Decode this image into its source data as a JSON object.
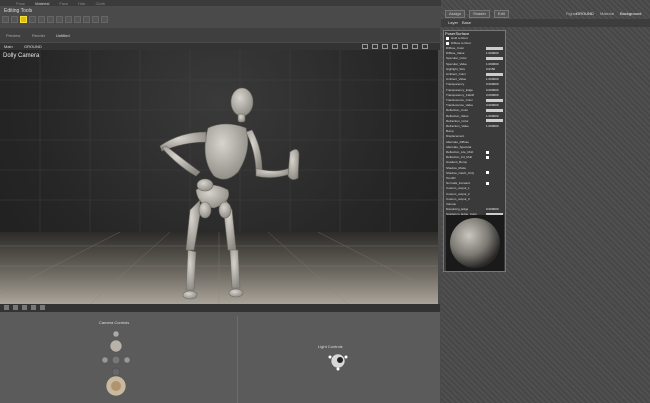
{
  "menu": {
    "items": [
      "Pose",
      "Material",
      "Face",
      "Hair",
      "Cloth"
    ],
    "active": "Material"
  },
  "title": "Editing Tools",
  "scene_tabs": [
    "Preview",
    "Render",
    "Untitled"
  ],
  "view": {
    "camera_select": "Main",
    "ground_select": "GROUND"
  },
  "viewport_label": "Dolly Camera",
  "camera_controls_label": "Camera Controls",
  "light_controls_label": "Light Controls",
  "right_panel": {
    "tabs": [
      "Assign",
      "Shader",
      "Edit"
    ],
    "figure_label": "Figure",
    "figure_value": "GROUND",
    "material_label": "Material",
    "material_value": "Background",
    "layer_label": "Layer",
    "layer_value": "Base",
    "panel_title": "PoserSurface",
    "checkbox_rows": [
      "Hold to Root",
      "Diffuse to Root"
    ],
    "rows": [
      {
        "label": "Diffuse_Color",
        "kind": "swatch"
      },
      {
        "label": "Diffuse_Value",
        "kind": "value",
        "value": "1.000000"
      },
      {
        "label": "Specular_Color",
        "kind": "swatch"
      },
      {
        "label": "Specular_Value",
        "kind": "value",
        "value": "1.000000"
      },
      {
        "label": "Highlight_Size",
        "kind": "value",
        "value": "0.0150"
      },
      {
        "label": "Ambient_Color",
        "kind": "swatch"
      },
      {
        "label": "Ambient_Value",
        "kind": "value",
        "value": "1.000000"
      },
      {
        "label": "Transparency",
        "kind": "value",
        "value": "0.000000"
      },
      {
        "label": "Transparency_Edge",
        "kind": "value",
        "value": "0.000000"
      },
      {
        "label": "Transparency_Falloff",
        "kind": "value",
        "value": "0.000000"
      },
      {
        "label": "Translucence_Color",
        "kind": "swatch"
      },
      {
        "label": "Translucence_Value",
        "kind": "value",
        "value": "0.000000"
      },
      {
        "label": "Reflection_Color",
        "kind": "swatch"
      },
      {
        "label": "Reflection_Value",
        "kind": "value",
        "value": "1.000000"
      },
      {
        "label": "Refraction_Color",
        "kind": "swatch"
      },
      {
        "label": "Refraction_Value",
        "kind": "value",
        "value": "1.000000"
      },
      {
        "label": "Bump",
        "kind": "value",
        "value": ""
      },
      {
        "label": "Displacement",
        "kind": "value",
        "value": ""
      },
      {
        "label": "Alternate_Diffuse",
        "kind": "value",
        "value": ""
      },
      {
        "label": "Alternate_Specular",
        "kind": "value",
        "value": ""
      },
      {
        "label": "Reflection_Lite_Mult",
        "kind": "check"
      },
      {
        "label": "Reflection_Kd_Mult",
        "kind": "check"
      },
      {
        "label": "Gradient_Bump",
        "kind": "value",
        "value": ""
      },
      {
        "label": "Shadow_Mode",
        "kind": "value",
        "value": ""
      },
      {
        "label": "Shadow_Catch_Only",
        "kind": "check"
      },
      {
        "label": "ToonID",
        "kind": "value",
        "value": ""
      },
      {
        "label": "Normals_Forward",
        "kind": "check"
      },
      {
        "label": "Custom_output_1",
        "kind": "value",
        "value": ""
      },
      {
        "label": "Custom_output_2",
        "kind": "value",
        "value": ""
      },
      {
        "label": "Custom_output_3",
        "kind": "value",
        "value": ""
      },
      {
        "label": "Volume",
        "kind": "value",
        "value": ""
      },
      {
        "label": "Dissolving_Edge",
        "kind": "value",
        "value": "0.000000"
      },
      {
        "label": "Scattering_Edge_Color",
        "kind": "swatch"
      }
    ]
  }
}
